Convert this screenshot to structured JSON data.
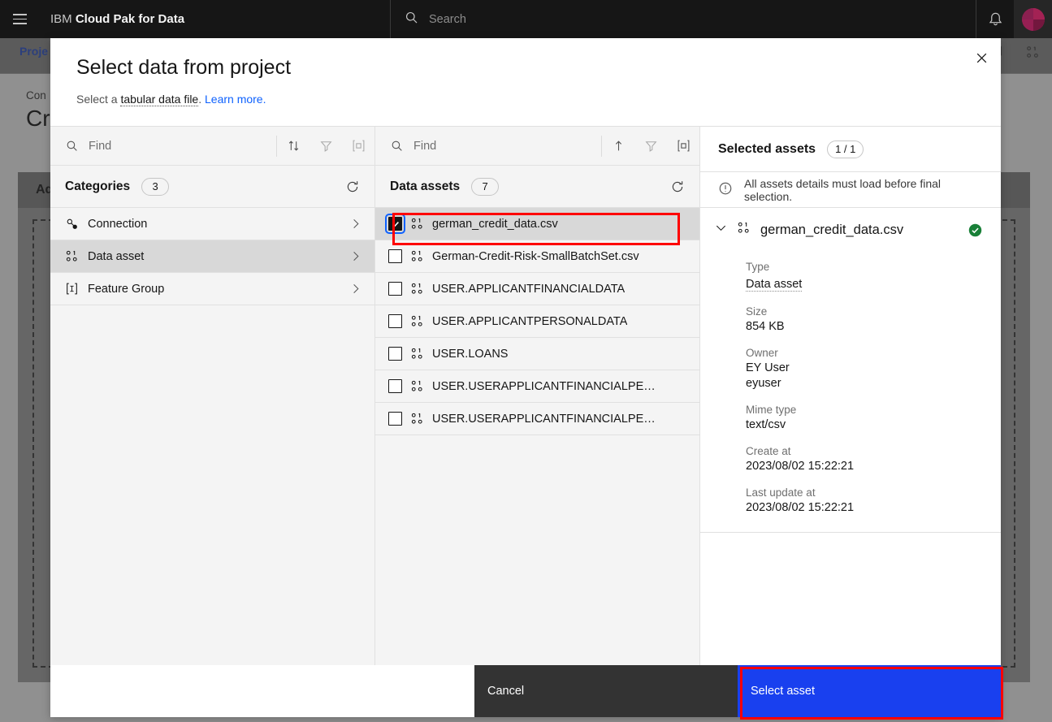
{
  "topbar": {
    "menu_icon": "hamburger-icon",
    "brand_prefix": "IBM",
    "brand_name": "Cloud Pak for Data",
    "search_placeholder": "Search",
    "search_icon": "search-icon",
    "bell_icon": "notification-bell-icon",
    "avatar_icon": "user-avatar-icon",
    "bg": "#161616",
    "avatar_color": "#a32254"
  },
  "background": {
    "breadcrumb": "Proje",
    "subtitle": "Con",
    "page_title": "Cr",
    "card_header": "Add",
    "tab_icons": [
      "comment-icon",
      "data-asset-icon"
    ]
  },
  "modal": {
    "title": "Select data from project",
    "subtitle_prefix": "Select a ",
    "subtitle_term": "tabular data file",
    "subtitle_suffix": ".",
    "learn_more": "Learn more.",
    "close_icon": "close-icon",
    "link_color": "#0f62fe"
  },
  "left_panel": {
    "find_placeholder": "Find",
    "find_value": "",
    "tools": [
      {
        "name": "sort-icon",
        "glyph": "sort-updown"
      },
      {
        "name": "filter-icon",
        "glyph": "funnel"
      },
      {
        "name": "fit-view-icon",
        "glyph": "bracket-square"
      }
    ],
    "section_label": "Categories",
    "section_count": "3",
    "refresh_icon": "refresh-icon",
    "items": [
      {
        "label": "Connection",
        "icon": "connection-icon",
        "active": false
      },
      {
        "label": "Data asset",
        "icon": "data-asset-icon",
        "active": true
      },
      {
        "label": "Feature Group",
        "icon": "feature-group-icon",
        "active": false
      }
    ]
  },
  "middle_panel": {
    "find_placeholder": "Find",
    "find_value": "",
    "tools": [
      {
        "name": "sort-ascending-icon",
        "glyph": "arrow-up"
      },
      {
        "name": "filter-icon",
        "glyph": "funnel"
      },
      {
        "name": "fit-view-icon",
        "glyph": "bracket-square"
      }
    ],
    "section_label": "Data assets",
    "section_count": "7",
    "refresh_icon": "refresh-icon",
    "assets": [
      {
        "label": "german_credit_data.csv",
        "checked": true,
        "highlighted": true
      },
      {
        "label": "German-Credit-Risk-SmallBatchSet.csv",
        "checked": false,
        "highlighted": false
      },
      {
        "label": "USER.APPLICANTFINANCIALDATA",
        "checked": false,
        "highlighted": false
      },
      {
        "label": "USER.APPLICANTPERSONALDATA",
        "checked": false,
        "highlighted": false
      },
      {
        "label": "USER.LOANS",
        "checked": false,
        "highlighted": false
      },
      {
        "label": "USER.USERAPPLICANTFINANCIALPE…",
        "checked": false,
        "highlighted": false
      },
      {
        "label": "USER.USERAPPLICANTFINANCIALPE…",
        "checked": false,
        "highlighted": false
      }
    ]
  },
  "right_panel": {
    "title": "Selected assets",
    "count_pill": "1 / 1",
    "notice_icon": "warning-circle-icon",
    "notice_text": "All assets details must load before final selection.",
    "asset": {
      "name": "german_credit_data.csv",
      "expand_icon": "chevron-down-icon",
      "asset_icon": "data-asset-icon",
      "status_icon": "checkmark-filled-icon",
      "status_color": "#198038",
      "fields": [
        {
          "label": "Type",
          "value": "Data asset",
          "dotted": true
        },
        {
          "label": "Size",
          "value": "854 KB",
          "dotted": false
        },
        {
          "label": "Owner",
          "value": "EY User",
          "value2": "eyuser",
          "dotted": false
        },
        {
          "label": "Mime type",
          "value": "text/csv",
          "dotted": false
        },
        {
          "label": "Create at",
          "value": "2023/08/02 15:22:21",
          "dotted": false
        },
        {
          "label": "Last update at",
          "value": "2023/08/02 15:22:21",
          "dotted": false
        }
      ]
    }
  },
  "footer": {
    "cancel_label": "Cancel",
    "primary_label": "Select asset",
    "primary_color": "#1940ef",
    "cancel_color": "#333333",
    "annotation_color": "#fe0000"
  }
}
